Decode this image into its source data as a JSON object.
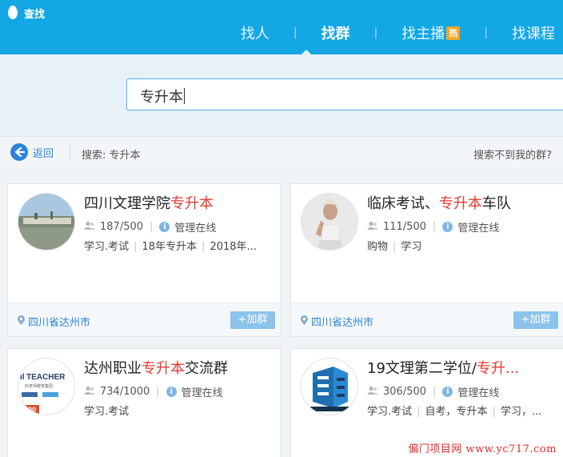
{
  "app": {
    "title": "查找"
  },
  "tabs": [
    {
      "label": "找人"
    },
    {
      "label": "找群"
    },
    {
      "label": "找主播",
      "badge": "热"
    },
    {
      "label": "找课程"
    }
  ],
  "search": {
    "value": "专升本"
  },
  "nav": {
    "back_label": "返回",
    "search_label": "搜索: 专升本",
    "not_found": "搜索不到我的群?"
  },
  "groups": [
    {
      "title_prefix": "四川文理学院",
      "title_highlight": "专升本",
      "title_suffix": "",
      "members": "187/500",
      "admin": "管理在线",
      "tags": [
        "学习.考试",
        "18年专升本",
        "2018年..."
      ],
      "location": "四川省达州市",
      "join_label": "+加群"
    },
    {
      "title_prefix": "临床考试、",
      "title_highlight": "专升本",
      "title_suffix": "车队",
      "members": "111/500",
      "admin": "管理在线",
      "tags": [
        "购物",
        "学习"
      ],
      "location": "四川省达州市",
      "join_label": "+加群"
    },
    {
      "title_prefix": "达州职业",
      "title_highlight": "专升本",
      "title_suffix": "交流群",
      "members": "734/1000",
      "admin": "管理在线",
      "tags": [
        "学习.考试"
      ],
      "avatar_text": {
        "brand": "TEACHER",
        "sub": "好老师教育集团",
        "count": "1000"
      }
    },
    {
      "title_prefix": "19文理第二学位/",
      "title_highlight": "专升...",
      "title_suffix": "",
      "members": "306/500",
      "admin": "管理在线",
      "tags": [
        "学习.考试",
        "自考，专升本",
        "学习，..."
      ]
    }
  ],
  "watermark": "偏门项目网 www.yc717.com",
  "colors": {
    "topbar": "#13a7e5",
    "highlight": "#e23b32",
    "link": "#2c85d6",
    "join": "#8cc3ec"
  }
}
